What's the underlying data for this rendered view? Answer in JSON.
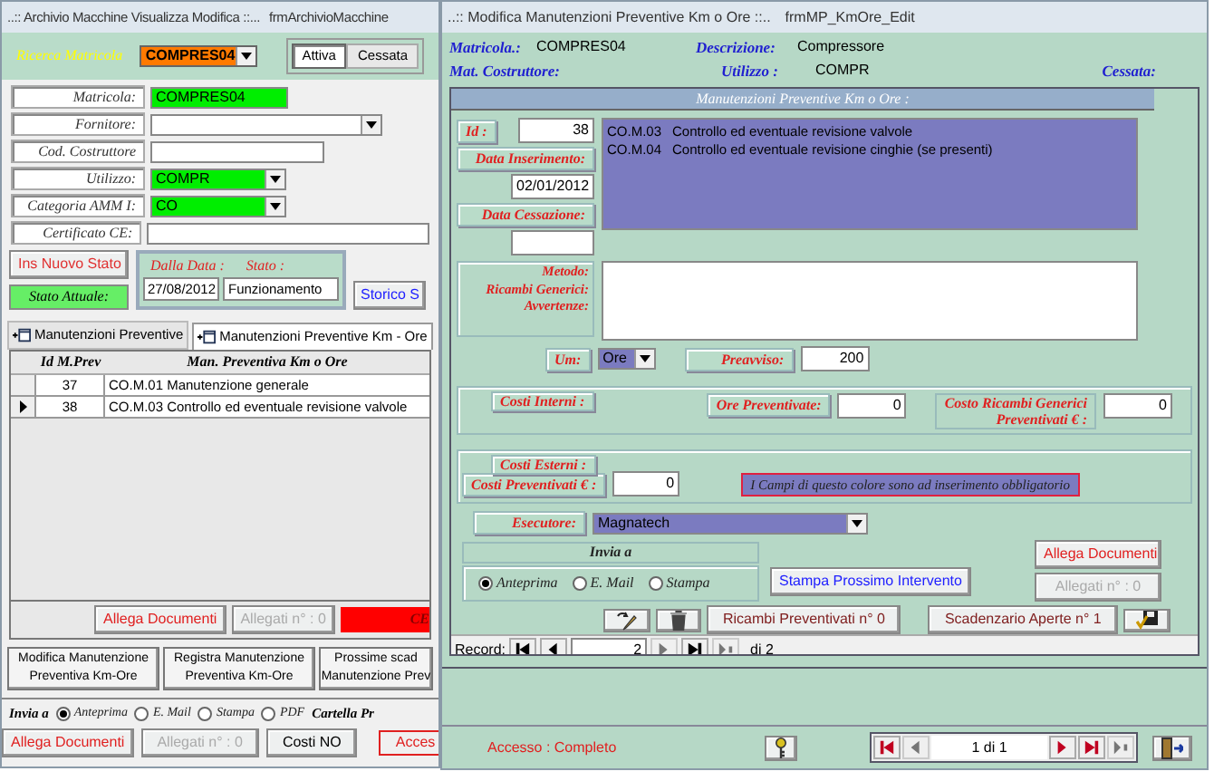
{
  "left_window": {
    "title": "..:: Archivio Macchine Visualizza Modifica ::...",
    "form_name": "frmArchivioMacchine",
    "search": {
      "label": "Ricerca Matricola",
      "value": "COMPRES04"
    },
    "status_tabs": [
      {
        "label": "Attiva",
        "selected": true
      },
      {
        "label": "Cessata",
        "selected": false
      }
    ],
    "fields": [
      {
        "label": "Matricola:",
        "value": "COMPRES04",
        "kind": "text",
        "highlighted": true
      },
      {
        "label": "Fornitore:",
        "kind": "combo",
        "highlighted": false
      },
      {
        "label": "Cod. Costruttore",
        "kind": "text",
        "highlighted": false
      },
      {
        "label": "Utilizzo:",
        "value": "COMPR",
        "kind": "combo",
        "highlighted": true
      },
      {
        "label": "Categoria AMM I:",
        "value": "CO",
        "kind": "combo",
        "highlighted": true
      },
      {
        "label": "Certificato CE:",
        "kind": "text",
        "highlighted": false
      }
    ],
    "new_state_button": "Ins Nuovo Stato",
    "current_state_label": "Stato Attuale:",
    "state": {
      "date_label": "Dalla Data :",
      "state_label": "Stato :",
      "date": "27/08/2012",
      "value": "Funzionamento"
    },
    "history_button": "Storico S",
    "tabs": [
      {
        "label": "Manutenzioni Preventive",
        "selected": false
      },
      {
        "label": "Manutenzioni Preventive Km - Ore",
        "selected": true
      }
    ],
    "table": {
      "columns": [
        "Id M.Prev",
        "Man. Preventiva Km o Ore"
      ],
      "rows": [
        {
          "id": "37",
          "description": "CO.M.01  Manutenzione generale",
          "current": false
        },
        {
          "id": "38",
          "description": "CO.M.03  Controllo ed eventuale revisione valvole",
          "current": true
        }
      ]
    },
    "subform_buttons": {
      "attach": "Allega Documenti",
      "attachments": "Allegati n° : 0",
      "ceased": "CE"
    },
    "action_buttons": [
      {
        "lines": [
          "Modifica Manutenzione",
          "Preventiva Km-Ore"
        ]
      },
      {
        "lines": [
          "Registra Manutenzione",
          "Preventiva Km-Ore"
        ]
      },
      {
        "lines": [
          "Prossime scad",
          "Manutenzione Prev"
        ]
      }
    ],
    "send": {
      "label": "Invia a",
      "options": [
        {
          "label": "Anteprima",
          "selected": true
        },
        {
          "label": "E. Mail",
          "selected": false
        },
        {
          "label": "Stampa",
          "selected": false
        },
        {
          "label": "PDF",
          "selected": false
        }
      ]
    },
    "folder_label": "Cartella Pr",
    "bottom_buttons": {
      "attach": "Allega Documenti",
      "attachments": "Allegati n° : 0",
      "costs": "Costi NO",
      "access": "Acces"
    }
  },
  "right_window": {
    "title": "..:: Modifica Manutenzioni Preventive Km o Ore ::..",
    "form_name": "frmMP_KmOre_Edit",
    "header": {
      "serial_label": "Matricola.:",
      "serial": "COMPRES04",
      "description_label": "Descrizione:",
      "description": "Compressore",
      "builder_label": "Mat. Costruttore:",
      "usage_label": "Utilizzo :",
      "usage": "COMPR",
      "ceased_label": "Cessata:"
    },
    "section_title": "Manutenzioni Preventive Km o Ore :",
    "id_label": "Id :",
    "id": "38",
    "insert_date_label": "Data Inserimento:",
    "insert_date": "02/01/2012",
    "end_date_label": "Data Cessazione:",
    "tasks": [
      {
        "code": "CO.M.03",
        "text": "Controllo ed eventuale revisione valvole"
      },
      {
        "code": "CO.M.04",
        "text": "Controllo ed eventuale revisione cinghie (se presenti)"
      }
    ],
    "notes_labels": [
      "Metodo:",
      "Ricambi Generici:",
      "Avvertenze:"
    ],
    "unit_label": "Um:",
    "unit": "Ore",
    "notice_label": "Preavviso:",
    "notice": "200",
    "internal_costs": {
      "title": "Costi Interni :",
      "hours_label": "Ore Preventivate:",
      "hours": "0",
      "parts_label": [
        "Costo Ricambi Generici",
        "Preventivati € :"
      ],
      "parts": "0"
    },
    "external_costs": {
      "title": "Costi Esterni :",
      "cost_label": "Costi Preventivati € :",
      "cost": "0",
      "legend": "I Campi di questo colore sono ad inserimento obbligatorio"
    },
    "executor_label": "Esecutore:",
    "executor": "Magnatech",
    "send": {
      "label": "Invia a",
      "options": [
        {
          "label": "Anteprima",
          "selected": true
        },
        {
          "label": "E. Mail",
          "selected": false
        },
        {
          "label": "Stampa",
          "selected": false
        }
      ]
    },
    "print_button": "Stampa Prossimo Intervento",
    "attach_button": "Allega Documenti",
    "attachments": "Allegati n° : 0",
    "parts_button": "Ricambi Preventivati n° 0",
    "schedule_button": "Scadenzario Aperte n° 1",
    "record_nav": {
      "label": "Record:",
      "value": "2",
      "total": "di 2"
    },
    "access": "Accesso : Completo",
    "form_nav": "1 di 1"
  }
}
